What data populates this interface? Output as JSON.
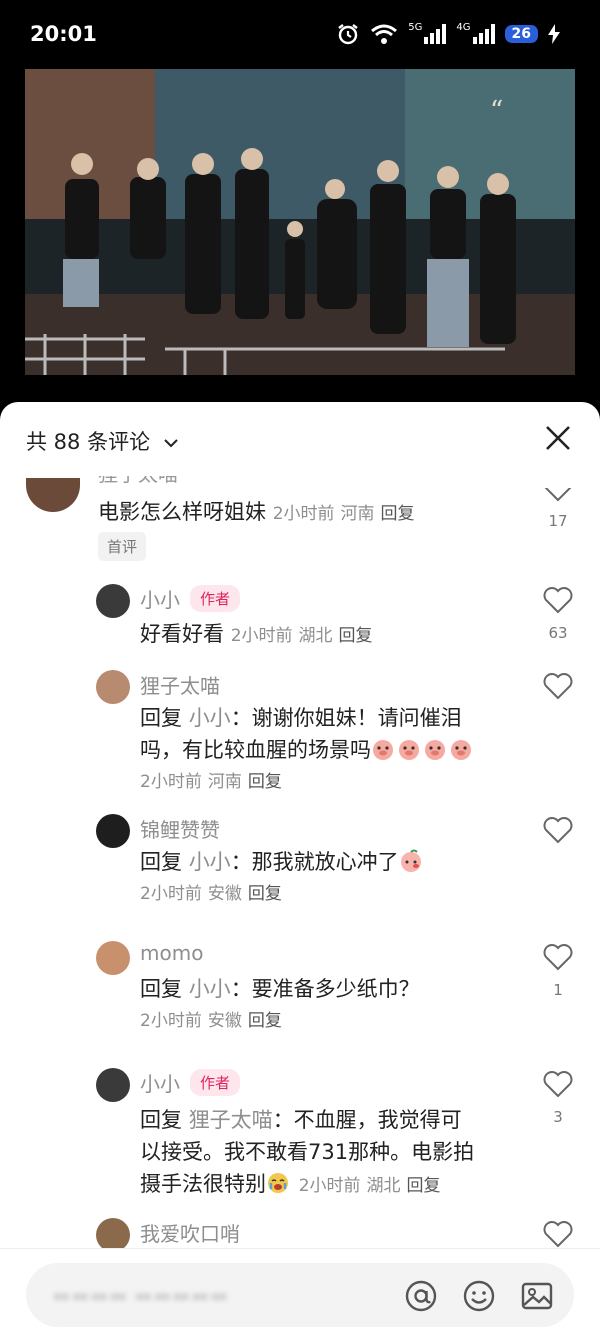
{
  "status": {
    "time": "20:01",
    "signal_1": "5G",
    "signal_2": "4G",
    "battery": "26"
  },
  "header": {
    "count_label": "共 88 条评论"
  },
  "comments": [
    {
      "author": "狸子太喵",
      "text": "电影怎么样呀姐妹",
      "time": "2小时前",
      "location": "河南",
      "reply_label": "回复",
      "tag": "首评",
      "likes": "17"
    },
    {
      "author": "小小",
      "badge": "作者",
      "text": "好看好看",
      "time": "2小时前",
      "location": "湖北",
      "reply_label": "回复",
      "likes": "63"
    },
    {
      "author": "狸子太喵",
      "reply_prefix": "回复",
      "reply_to": "小小",
      "text_line1": "：谢谢你姐妹！请问催泪",
      "text_line2": "吗，有比较血腥的场景吗",
      "time": "2小时前",
      "location": "河南",
      "reply_label": "回复",
      "emoji": "pig-crying-emoji"
    },
    {
      "author": "锦鲤赞赞",
      "reply_prefix": "回复",
      "reply_to": "小小",
      "text": "：那我就放心冲了",
      "time": "2小时前",
      "location": "安徽",
      "reply_label": "回复",
      "emoji": "peach-blush-emoji"
    },
    {
      "author": "momo",
      "reply_prefix": "回复",
      "reply_to": "小小",
      "text": "：要准备多少纸巾？",
      "time": "2小时前",
      "location": "安徽",
      "reply_label": "回复",
      "likes": "1"
    },
    {
      "author": "小小",
      "badge": "作者",
      "reply_prefix": "回复",
      "reply_to": "狸子太喵",
      "text_line1": "：不血腥，我觉得可",
      "text_line2": "以接受。我不敢看731那种。电影拍",
      "text_line3": "摄手法很特别",
      "time": "2小时前",
      "location": "湖北",
      "reply_label": "回复",
      "likes": "3",
      "emoji": "crying-face-emoji"
    },
    {
      "author": "我爱吹口哨"
    }
  ],
  "colors": {
    "author_badge": "#e0245e",
    "battery": "#2b5fd9"
  }
}
